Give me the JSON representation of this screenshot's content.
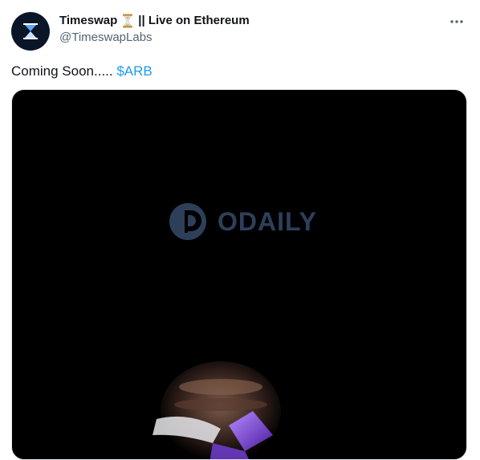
{
  "author": {
    "display_name": "Timeswap",
    "name_suffix": "|| Live on Ethereum",
    "handle": "@TimeswapLabs"
  },
  "tweet": {
    "text": "Coming Soon..... ",
    "cashtag": "$ARB"
  },
  "media": {
    "watermark_text": "ODAILY"
  },
  "icons": {
    "avatar": "timeswap-logo",
    "name_emoji": "hourglass-icon",
    "more": "more-options-icon",
    "watermark_logo": "odaily-logo-icon"
  },
  "colors": {
    "accent": "#1d9bf0",
    "text": "#0f1419",
    "secondary_text": "#536471",
    "media_background": "#000000"
  }
}
